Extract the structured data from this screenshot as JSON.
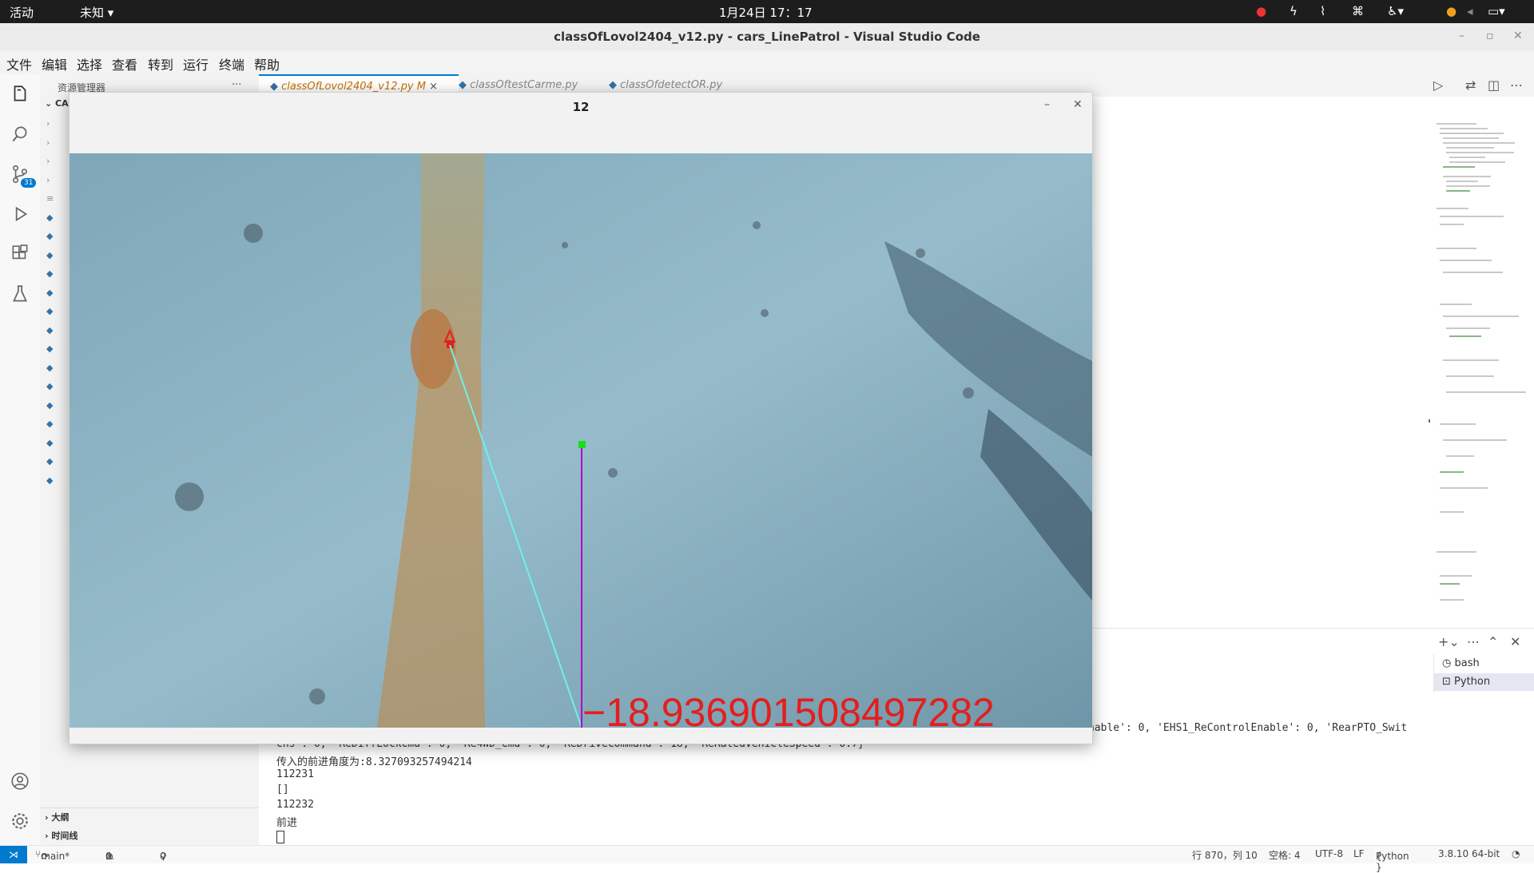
{
  "topbar": {
    "activities": "活动",
    "unknown": "未知",
    "datetime": "1月24日  17：17"
  },
  "window": {
    "title": "classOfLovol2404_v12.py - cars_LinePatrol - Visual Studio Code"
  },
  "menu": {
    "items": [
      "文件",
      "编辑",
      "选择",
      "查看",
      "转到",
      "运行",
      "终端",
      "帮助"
    ]
  },
  "activity": {
    "scm_badge": "31"
  },
  "explorer": {
    "title": "资源管理器",
    "more": "···",
    "root_label": "CA",
    "outline": "大纲",
    "timeline": "时间线"
  },
  "tabs": [
    {
      "label": "classOfLovol2404_v12.py",
      "modified": "M",
      "close": "×"
    },
    {
      "label": "classOftestCarme.py"
    },
    {
      "label": "classOfdetectOR.py"
    }
  ],
  "cv_window": {
    "title": "12",
    "overlay_text": "−18.936901508497282"
  },
  "terminal": {
    "partial_right": "nable': 0, 'EHS1_ReControlEnable': 0, 'RearPTO_Swit",
    "line0": "chs': 0, 'ReDiffLockCmd': 0, 'Re4WD_Cmd': 0, 'ReDriveCommand': 18, 'ReRatedVehicleSpeed': 0.7}",
    "line1": "传入的前进角度为:8.327093257494214",
    "line2": "112231",
    "line3": "[]",
    "line4": "112232",
    "line5": "前进",
    "sessions": [
      "bash",
      "Python"
    ]
  },
  "status": {
    "branch": "main*",
    "errors": "0",
    "warnings": "0",
    "ports": "0",
    "position": "行 870，列 10",
    "spaces": "空格: 4",
    "encoding": "UTF-8",
    "eol": "LF",
    "language": "Python",
    "interpreter": "3.8.10 64-bit"
  },
  "colors": {
    "accent": "#007acc",
    "cv_line": "#6ff0e8",
    "cv_vertical": "#b000c8",
    "cv_text": "#e41e1e",
    "cv_marker_green": "#18e018"
  }
}
